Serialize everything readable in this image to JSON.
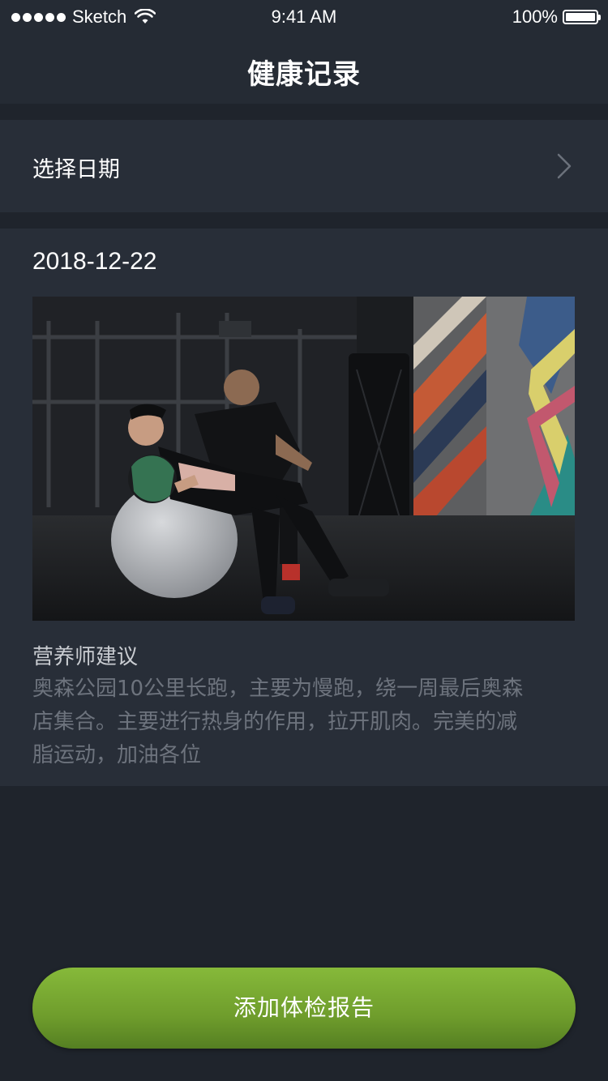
{
  "status_bar": {
    "carrier": "Sketch",
    "time": "9:41 AM",
    "battery": "100%"
  },
  "nav": {
    "title": "健康记录"
  },
  "date_picker": {
    "label": "选择日期",
    "icon": "chevron-right-icon"
  },
  "record": {
    "date": "2018-12-22",
    "photo_icon": "fitness-photo",
    "advice_title": "营养师建议",
    "advice_lines": [
      "奥森公园10公里长跑，主要为慢跑，绕一周最后奥森",
      "店集合。主要进行热身的作用，拉开肌肉。完美的减",
      "脂运动，加油各位"
    ]
  },
  "actions": {
    "add_report_label": "添加体检报告",
    "accent_color": "#7fb235"
  }
}
